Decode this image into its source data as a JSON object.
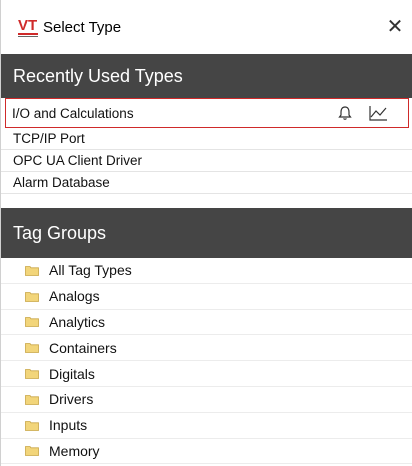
{
  "window": {
    "title": "Select Type",
    "close_glyph": "✕",
    "logo_text": "VT",
    "accent_color": "#cf2a2a",
    "header_color": "#454545"
  },
  "recent": {
    "header": "Recently Used Types",
    "items": [
      {
        "label": "I/O and Calculations",
        "selected": true
      },
      {
        "label": "TCP/IP Port"
      },
      {
        "label": "OPC UA Client Driver"
      },
      {
        "label": "Alarm Database"
      }
    ],
    "icons": [
      "bell-icon",
      "trend-chart-icon"
    ]
  },
  "groups": {
    "header": "Tag Groups",
    "items": [
      {
        "label": "All Tag Types"
      },
      {
        "label": "Analogs"
      },
      {
        "label": "Analytics"
      },
      {
        "label": "Containers"
      },
      {
        "label": "Digitals"
      },
      {
        "label": "Drivers"
      },
      {
        "label": "Inputs"
      },
      {
        "label": "Memory"
      }
    ],
    "folder_icon": "folder-icon",
    "folder_color": "#f2d57a"
  }
}
